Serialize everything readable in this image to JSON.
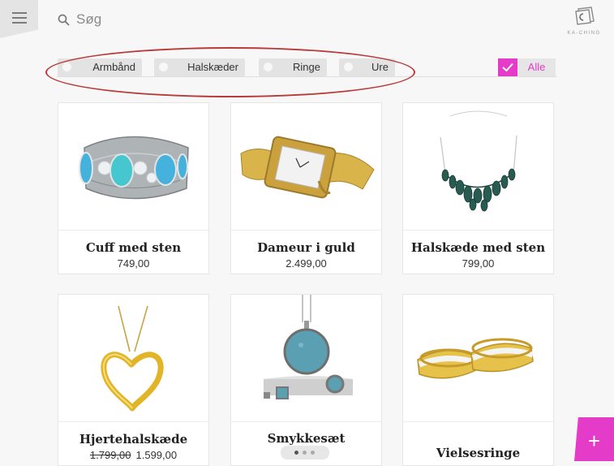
{
  "header": {
    "search_placeholder": "Søg",
    "logo_text": "KA-CHING"
  },
  "filters": {
    "chips": [
      {
        "label": "Armbånd"
      },
      {
        "label": "Halskæder"
      },
      {
        "label": "Ringe"
      },
      {
        "label": "Ure"
      }
    ],
    "all": {
      "label": "Alle",
      "checked": true
    }
  },
  "products": [
    {
      "name": "Cuff med sten",
      "price": "749,00"
    },
    {
      "name": "Dameur i guld",
      "price": "2.499,00"
    },
    {
      "name": "Halskæde med sten",
      "price": "799,00"
    },
    {
      "name": "Hjertehalskæde",
      "old_price": "1.799,00",
      "price": "1.599,00"
    },
    {
      "name": "Smykkesæt"
    },
    {
      "name": "Vielsesringe"
    }
  ],
  "pager": {
    "pages": 3,
    "active": 1
  },
  "colors": {
    "accent": "#e43bc8",
    "annotation": "#b83a3a"
  },
  "icons": [
    "menu-icon",
    "search-icon",
    "checkmark-icon",
    "plus-icon"
  ]
}
